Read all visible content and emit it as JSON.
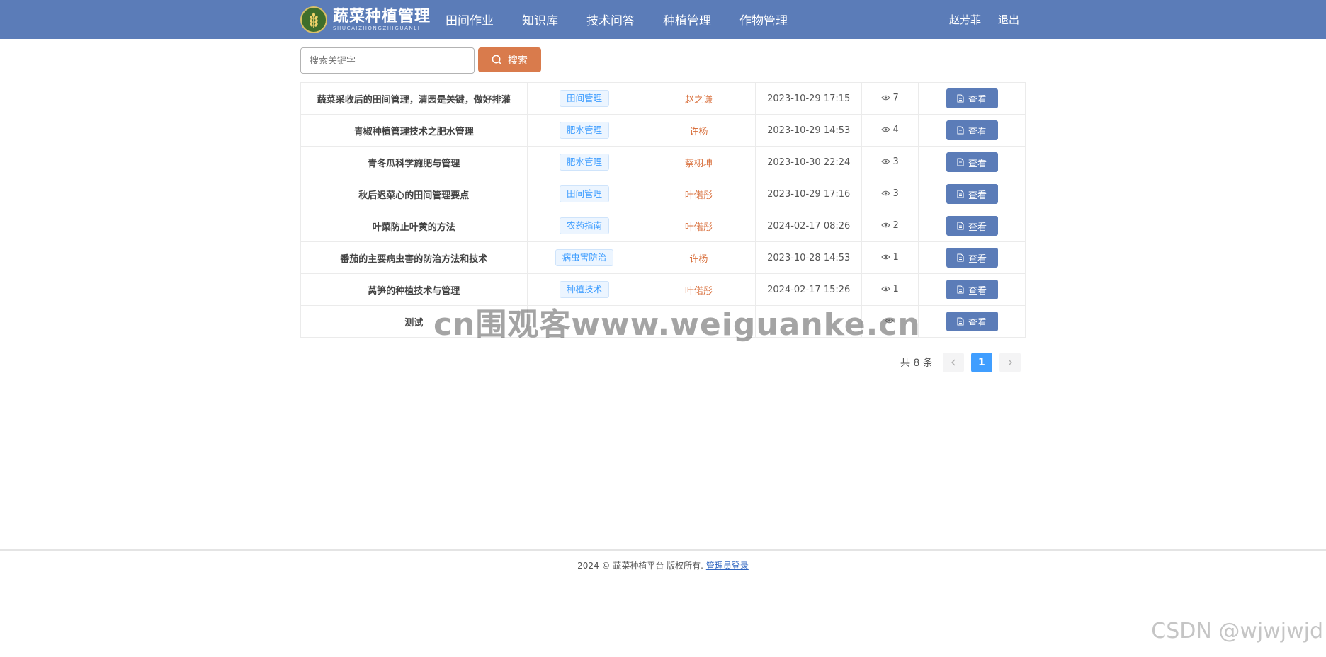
{
  "brand": {
    "title": "蔬菜种植管理",
    "subtitle": "SHUCAIZHONGZHIGUANLI",
    "logo_icon": "wheat-logo-icon"
  },
  "nav": {
    "items": [
      {
        "label": "田间作业"
      },
      {
        "label": "知识库"
      },
      {
        "label": "技术问答"
      },
      {
        "label": "种植管理"
      },
      {
        "label": "作物管理"
      }
    ]
  },
  "user": {
    "name": "赵芳菲",
    "logout_label": "退出"
  },
  "search": {
    "placeholder": "搜索关键字",
    "value": "",
    "button_label": "搜索",
    "button_color": "#d97b4c"
  },
  "colors": {
    "header": "#5b7cb8",
    "author": "#d9703d",
    "tag": "#409eff",
    "page_active": "#409eff"
  },
  "articles": [
    {
      "title": "蔬菜采收后的田间管理，清园是关键，做好排灌",
      "tag": "田间管理",
      "author": "赵之谦",
      "date": "2023-10-29 17:15",
      "views": "7",
      "action": "查看"
    },
    {
      "title": "青椒种植管理技术之肥水管理",
      "tag": "肥水管理",
      "author": "许杨",
      "date": "2023-10-29 14:53",
      "views": "4",
      "action": "查看"
    },
    {
      "title": "青冬瓜科学施肥与管理",
      "tag": "肥水管理",
      "author": "蔡栩坤",
      "date": "2023-10-30 22:24",
      "views": "3",
      "action": "查看"
    },
    {
      "title": "秋后迟菜心的田间管理要点",
      "tag": "田间管理",
      "author": "叶偌彤",
      "date": "2023-10-29 17:16",
      "views": "3",
      "action": "查看"
    },
    {
      "title": "叶菜防止叶黄的方法",
      "tag": "农药指南",
      "author": "叶偌彤",
      "date": "2024-02-17 08:26",
      "views": "2",
      "action": "查看"
    },
    {
      "title": "番茄的主要病虫害的防治方法和技术",
      "tag": "病虫害防治",
      "author": "许杨",
      "date": "2023-10-28 14:53",
      "views": "1",
      "action": "查看"
    },
    {
      "title": "莴笋的种植技术与管理",
      "tag": "种植技术",
      "author": "叶偌彤",
      "date": "2024-02-17 15:26",
      "views": "1",
      "action": "查看"
    },
    {
      "title": "测试",
      "tag": "",
      "author": "",
      "date": "",
      "views": "",
      "action": "查看"
    }
  ],
  "pagination": {
    "total_label": "共 8 条",
    "current_page": "1"
  },
  "footer": {
    "copyright": "2024 © 蔬菜种植平台 版权所有.",
    "admin_link": "管理员登录"
  },
  "watermarks": {
    "center": "cn围观客www.weiguanke.cn",
    "corner": "CSDN @wjwjwjd"
  }
}
